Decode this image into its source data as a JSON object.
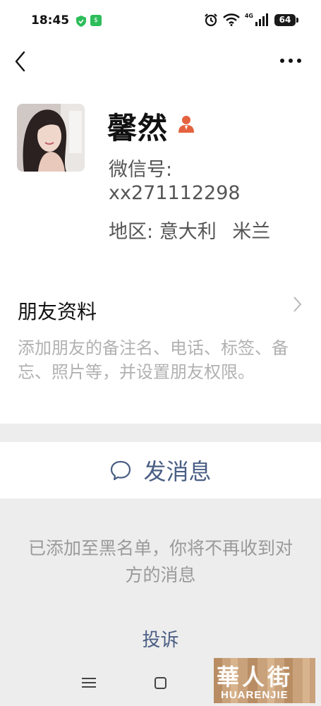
{
  "status_bar": {
    "time": "18:45",
    "network": "4G",
    "battery": "64"
  },
  "profile": {
    "nickname": "馨然",
    "wechat_id_label": "微信号:",
    "wechat_id": "xx271112298",
    "region_label": "地区:",
    "region_country": "意大利",
    "region_city": "米兰"
  },
  "friend_info": {
    "title": "朋友资料",
    "description": "添加朋友的备注名、电话、标签、备忘、照片等，并设置朋友权限。"
  },
  "actions": {
    "send_message": "发消息"
  },
  "blacklist": {
    "notice": "已添加至黑名单，你将不再收到对方的消息",
    "report": "投诉"
  },
  "watermark": {
    "logo_text": "華人街",
    "latin_text": "HUARENJIE"
  },
  "colors": {
    "link": "#4a5e84",
    "gray_text": "#b1b1b1",
    "background_gray": "#ededed",
    "verified_badge": "#e5623f"
  },
  "icons": {
    "back": "chevron-left-icon",
    "more": "more-dots-icon",
    "chat": "chat-bubble-icon",
    "chevron": "chevron-right-icon"
  }
}
